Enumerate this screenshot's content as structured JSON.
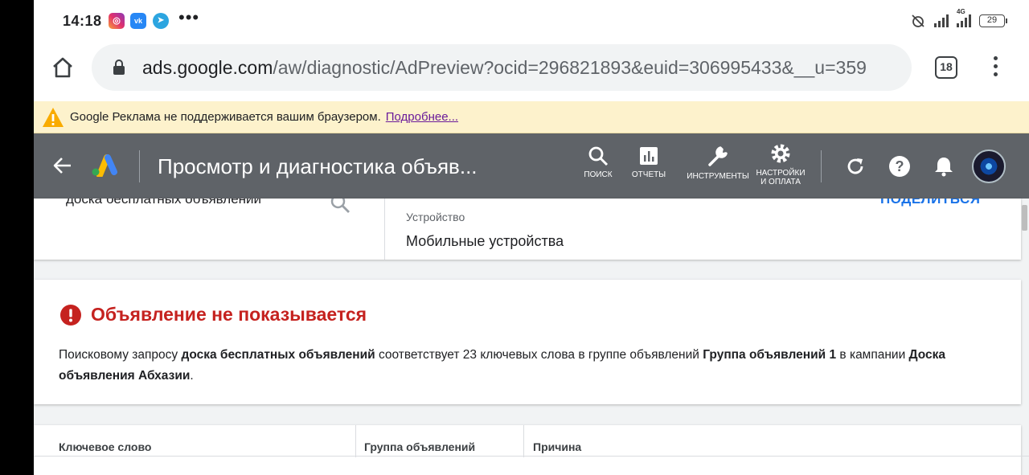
{
  "status_bar": {
    "time": "14:18",
    "apps": [
      "instagram-icon",
      "vk-icon",
      "telegram-icon"
    ],
    "more": "•••",
    "network": "4G",
    "battery": "29"
  },
  "browser": {
    "url_domain": "ads.google.com",
    "url_path": "/aw/diagnostic/AdPreview?ocid=296821893&euid=306995433&__u=359",
    "tab_count": "18"
  },
  "banner": {
    "text": "Google Реклама не поддерживается вашим браузером.",
    "link": "Подробнее..."
  },
  "header": {
    "title": "Просмотр и диагностика объяв...",
    "tools": {
      "search": "ПОИСК",
      "reports": "ОТЧЕТЫ",
      "tools": "ИНСТРУМЕНТЫ",
      "settings_line1": "НАСТРОЙКИ",
      "settings_line2": "И ОПЛАТА"
    }
  },
  "search_card": {
    "query": "доска бесплатных объявлений",
    "device_label": "Устройство",
    "device_value": "Мобильные устройства",
    "share": "ПОДЕЛИТЬСЯ"
  },
  "status_card": {
    "title": "Объявление не показывается",
    "desc_part1": "Поисковому запросу ",
    "desc_query": "доска бесплатных объявлений",
    "desc_part2": " соответствует 23 ключевых слова в группе объявлений ",
    "desc_group": "Группа объявлений 1",
    "desc_part3": " в кампании ",
    "desc_campaign": "Доска объявления Абхазии",
    "desc_end": "."
  },
  "table": {
    "columns": [
      "Ключевое слово",
      "Группа объявлений",
      "Причина"
    ]
  },
  "colors": {
    "header_bg": "#5f6368",
    "banner_bg": "#fdf2cc",
    "error_red": "#c5221f",
    "link_blue": "#1a73e8"
  }
}
